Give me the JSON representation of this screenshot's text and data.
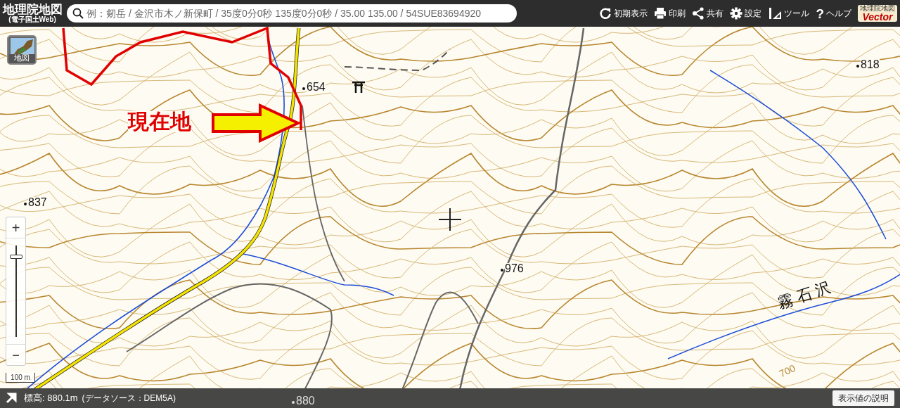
{
  "header": {
    "logo_title": "地理院地図",
    "logo_subtitle": "(電子国土Web)",
    "search": {
      "placeholder": "例：剱岳 / 金沢市木ノ新保町 / 35度0分0秒 135度0分0秒 / 35.00 135.00 / 54SUE83694920"
    },
    "toolbar": [
      {
        "kind": "reset",
        "label": "初期表示"
      },
      {
        "kind": "print",
        "label": "印刷"
      },
      {
        "kind": "share",
        "label": "共有"
      },
      {
        "kind": "settings",
        "label": "設定"
      },
      {
        "kind": "tools",
        "label": "ツール"
      },
      {
        "kind": "help",
        "icon": "?",
        "label": "ヘルプ"
      }
    ],
    "badge": {
      "top": "地理院地図",
      "bottom": "Vector"
    }
  },
  "layer_button": {
    "label": "地図"
  },
  "zoom": {
    "plus": "+",
    "minus": "−",
    "level": 0.88
  },
  "scale": "100 m",
  "map": {
    "labels": [
      {
        "kind": "current",
        "text": "現在地"
      },
      {
        "kind": "spot",
        "text": "654"
      },
      {
        "kind": "spot",
        "text": "837"
      },
      {
        "kind": "spot",
        "text": "976"
      },
      {
        "kind": "spot",
        "text": "818"
      },
      {
        "kind": "stream",
        "text": "霧石沢"
      },
      {
        "kind": "contour",
        "text": "700"
      },
      {
        "kind": "spot",
        "text": "880"
      }
    ]
  },
  "status_bar": {
    "elevation": "標高: 880.1m",
    "source": "(データソース：DEM5A)",
    "button": "表示値の説明"
  }
}
